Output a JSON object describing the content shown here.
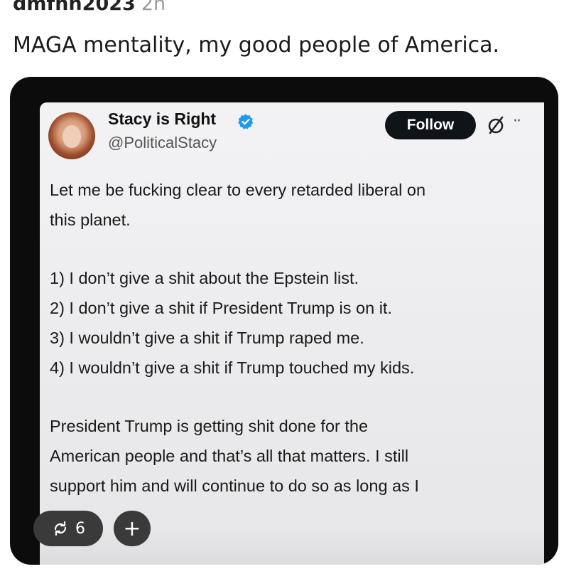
{
  "post": {
    "username": "dmfnh2023",
    "time_ago": "2h",
    "caption": "MAGA mentality, my good people of America."
  },
  "tweet": {
    "display_name": "Stacy is Right",
    "handle": "@PoliticalStacy",
    "follow_label": "Follow",
    "more_label": "··",
    "verified_color": "#1d9bf0",
    "lines": [
      "Let me be fucking clear to every retarded liberal on",
      "this planet.",
      "",
      "1) I don’t give a shit about the Epstein list.",
      "2) I don’t give a shit if President Trump is on it.",
      "3) I wouldn’t give a shit if Trump raped me.",
      "4) I wouldn’t give a shit if Trump touched my kids.",
      "",
      "President Trump is getting shit done for the",
      "American people and that’s all that matters. I still",
      "support him and will continue to do so as long as I"
    ]
  },
  "actions": {
    "repost_count": "6",
    "repost_icon": "repost-icon",
    "add_label": "+"
  }
}
